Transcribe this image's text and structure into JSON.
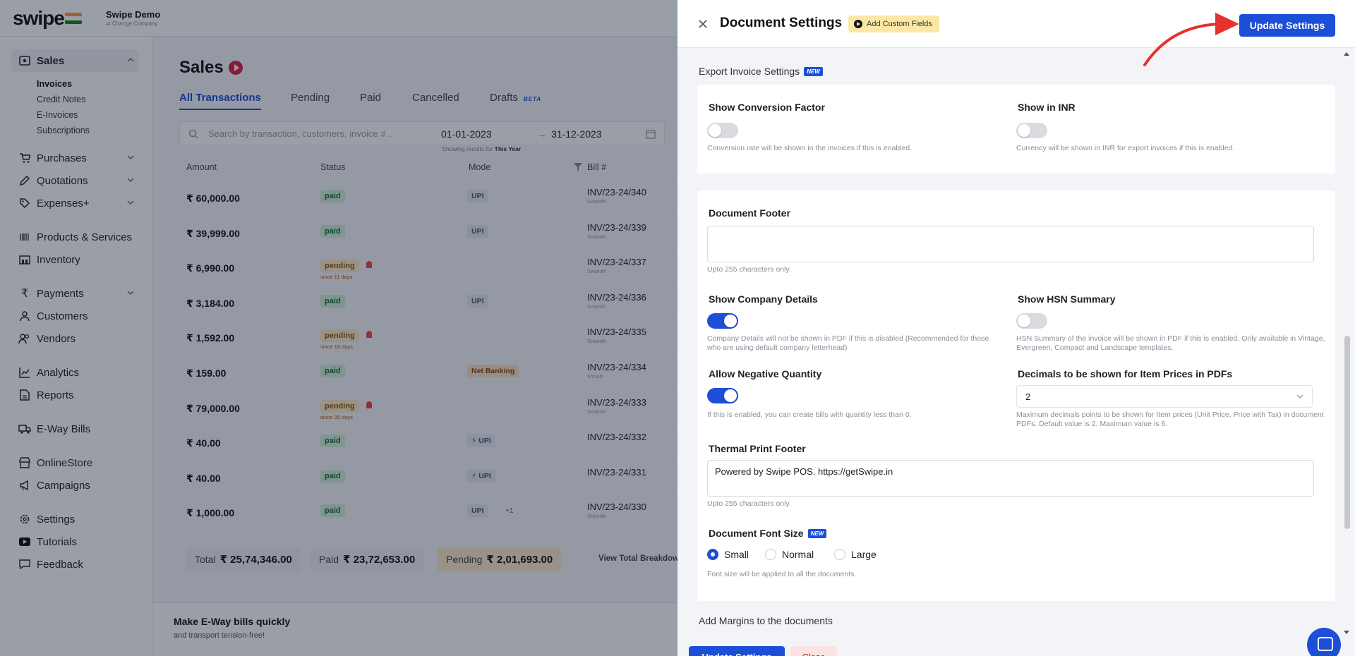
{
  "app": {
    "logo": "swipe",
    "company_name": "Swipe Demo",
    "company_sub": "⇄ Change Company"
  },
  "sidebar": {
    "sales": "Sales",
    "sales_sub": [
      "Invoices",
      "Credit Notes",
      "E-Invoices",
      "Subscriptions"
    ],
    "purchases": "Purchases",
    "quotations": "Quotations",
    "expenses": "Expenses+",
    "products": "Products & Services",
    "inventory": "Inventory",
    "payments": "Payments",
    "customers": "Customers",
    "vendors": "Vendors",
    "analytics": "Analytics",
    "reports": "Reports",
    "eway": "E-Way Bills",
    "onlinestore": "OnlineStore",
    "campaigns": "Campaigns",
    "settings": "Settings",
    "tutorials": "Tutorials",
    "feedback": "Feedback"
  },
  "sales": {
    "title": "Sales",
    "tabs": [
      "All Transactions",
      "Pending",
      "Paid",
      "Cancelled",
      "Drafts"
    ],
    "beta": "BETA",
    "search_placeholder": "Search by transaction, customers, invoice #...",
    "date_from": "01-01-2023",
    "date_arrow": "→",
    "date_to": "31-12-2023",
    "showing_prefix": "Showing results for",
    "showing_period": "This Year",
    "columns": [
      "Amount",
      "Status",
      "Mode",
      "Bill #"
    ],
    "rows": [
      {
        "amount": "₹ 60,000.00",
        "status": "paid",
        "since": "",
        "mode": "UPI",
        "extra": "",
        "bill": "INV/23-24/340",
        "bill_sub": "Swamith"
      },
      {
        "amount": "₹ 39,999.00",
        "status": "paid",
        "since": "",
        "mode": "UPI",
        "extra": "",
        "bill": "INV/23-24/339",
        "bill_sub": "Swamith"
      },
      {
        "amount": "₹ 6,990.00",
        "status": "pending",
        "since": "since 11 days",
        "mode": "",
        "extra": "",
        "bill": "INV/23-24/337",
        "bill_sub": "Swamith"
      },
      {
        "amount": "₹ 3,184.00",
        "status": "paid",
        "since": "",
        "mode": "UPI",
        "extra": "",
        "bill": "INV/23-24/336",
        "bill_sub": "Swamith"
      },
      {
        "amount": "₹ 1,592.00",
        "status": "pending",
        "since": "since 18 days",
        "mode": "",
        "extra": "",
        "bill": "INV/23-24/335",
        "bill_sub": "Swamith"
      },
      {
        "amount": "₹ 159.00",
        "status": "paid",
        "since": "",
        "mode": "Net Banking",
        "extra": "",
        "bill": "INV/23-24/334",
        "bill_sub": "Shivam"
      },
      {
        "amount": "₹ 79,000.00",
        "status": "pending",
        "since": "since 28 days",
        "mode": "",
        "extra": "",
        "bill": "INV/23-24/333",
        "bill_sub": "Swamith"
      },
      {
        "amount": "₹ 40.00",
        "status": "paid",
        "since": "",
        "mode": "⚡ UPI",
        "extra": "",
        "bill": "INV/23-24/332",
        "bill_sub": ""
      },
      {
        "amount": "₹ 40.00",
        "status": "paid",
        "since": "",
        "mode": "⚡ UPI",
        "extra": "",
        "bill": "INV/23-24/331",
        "bill_sub": ""
      },
      {
        "amount": "₹ 1,000.00",
        "status": "paid",
        "since": "",
        "mode": "UPI",
        "extra": "+1",
        "bill": "INV/23-24/330",
        "bill_sub": "Swamith"
      }
    ],
    "totals": {
      "total_label": "Total",
      "total_value": "₹ 25,74,346.00",
      "paid_label": "Paid",
      "paid_value": "₹ 23,72,653.00",
      "pending_label": "Pending",
      "pending_value": "₹ 2,01,693.00",
      "breakdown": "View Total Breakdown"
    },
    "promo_title": "Make E-Way bills quickly",
    "promo_sub": "and transport tension-free!"
  },
  "drawer": {
    "title": "Document Settings",
    "custom_fields": "Add Custom Fields",
    "update_label": "Update Settings",
    "close_label": "Close",
    "new_badge": "NEW",
    "export_section": "Export Invoice Settings",
    "show_conversion": {
      "label": "Show Conversion Factor",
      "help": "Conversion rate will be shown in the invoices if this is enabled.",
      "on": false
    },
    "show_inr": {
      "label": "Show in INR",
      "help": "Currency will be shown in INR for export invoices if this is enabled.",
      "on": false
    },
    "doc_footer": {
      "label": "Document Footer",
      "value": "",
      "help": "Upto 255 characters only."
    },
    "company_details": {
      "label": "Show Company Details",
      "help": "Company Details will not be shown in PDF if this is disabled (Recommended for those who are using default company letterhead)",
      "on": true
    },
    "hsn_summary": {
      "label": "Show HSN Summary",
      "help": "HSN Summary of the invoice will be shown in PDF if this is enabled. Only available in Vintage, Evergreen, Compact and Landscape templates.",
      "on": false
    },
    "negative_qty": {
      "label": "Allow Negative Quantity",
      "help": "If this is enabled, you can create bills with quantity less than 0.",
      "on": true
    },
    "decimals": {
      "label": "Decimals to be shown for Item Prices in PDFs",
      "value": "2",
      "help": "Maximum decimals points to be shown for Item prices (Unit Price, Price with Tax) in document PDFs. Default value is 2. Maximum value is 6."
    },
    "thermal_footer": {
      "label": "Thermal Print Footer",
      "value": "Powered by Swipe POS. https://getSwipe.in",
      "help": "Upto 255 characters only."
    },
    "font_size": {
      "label": "Document Font Size",
      "options": [
        "Small",
        "Normal",
        "Large"
      ],
      "selected": "Small",
      "help": "Font size will be applied to all the documents."
    },
    "margins_section": "Add Margins to the documents"
  },
  "colors": {
    "accent": "#1d4ed8",
    "arrow": "#e5322d"
  }
}
